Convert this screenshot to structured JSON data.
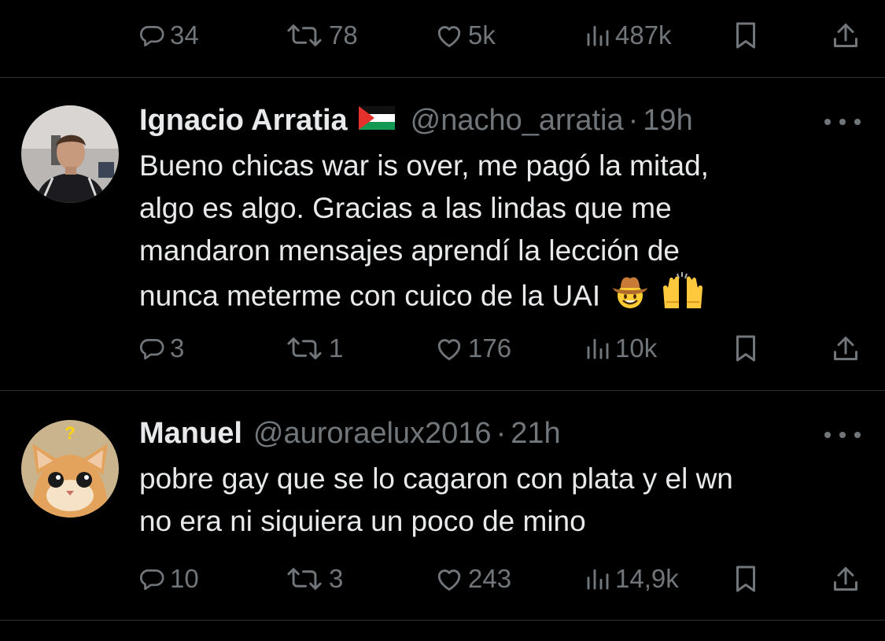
{
  "tweets": [
    {
      "actions": {
        "replies": "34",
        "reposts": "78",
        "likes": "5k",
        "views": "487k"
      }
    },
    {
      "display_name": "Ignacio Arratia",
      "flag_icon": "palestine-flag",
      "handle": "@nacho_arratia",
      "separator": "·",
      "time": "19h",
      "text_lines": [
        "Bueno chicas war is over, me pagó la mitad,",
        "algo es algo. Gracias a las lindas que me",
        "mandaron mensajes aprendí la lección de",
        "nunca meterme con cuico de la UAI"
      ],
      "emojis": [
        "cowboy-face",
        "raising-hands"
      ],
      "actions": {
        "replies": "3",
        "reposts": "1",
        "likes": "176",
        "views": "10k"
      }
    },
    {
      "display_name": "Manuel",
      "handle": "@auroraelux2016",
      "separator": "·",
      "time": "21h",
      "text_lines": [
        "pobre gay que se lo cagaron con plata y el wn",
        "no era ni siquiera un poco de mino"
      ],
      "actions": {
        "replies": "10",
        "reposts": "3",
        "likes": "243",
        "views": "14,9k"
      }
    }
  ],
  "colors": {
    "background": "#000000",
    "text": "#e7e9ea",
    "secondary": "#71767b",
    "divider": "#2f3336"
  }
}
